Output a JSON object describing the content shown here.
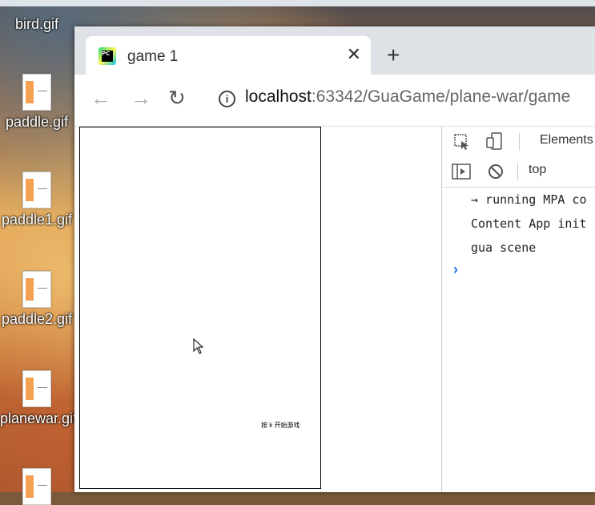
{
  "desktop": {
    "icons": [
      {
        "label": "bird.gif"
      },
      {
        "label": "paddle.gif"
      },
      {
        "label": "paddle1.gif"
      },
      {
        "label": "paddle2.gif"
      },
      {
        "label": "planewar.gif"
      }
    ]
  },
  "browser": {
    "tab": {
      "title": "game 1",
      "close": "✕"
    },
    "new_tab": "+",
    "toolbar": {
      "back": "←",
      "forward": "→",
      "reload": "↻",
      "info": "i",
      "url_host": "localhost",
      "url_rest": ":63342/GuaGame/plane-war/game"
    }
  },
  "page": {
    "canvas_text": "按 k 开始游戏"
  },
  "devtools": {
    "tabs": [
      {
        "label": "Elements"
      }
    ],
    "context": "top",
    "console_lines": [
      "→ running MPA co",
      "Content App init",
      "gua scene"
    ],
    "prompt": "›"
  }
}
